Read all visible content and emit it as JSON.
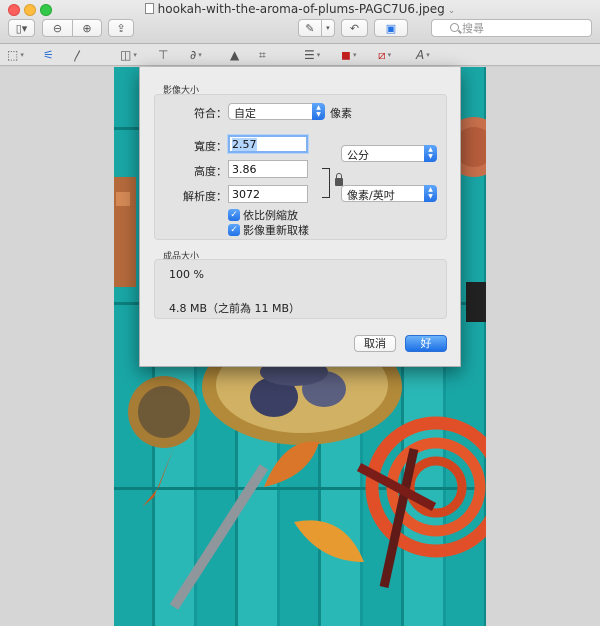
{
  "window": {
    "title": "hookah-with-the-aroma-of-plums-PAGC7U6.jpeg",
    "title_chevron": "⌄"
  },
  "toolbar": {
    "search_placeholder": "搜尋"
  },
  "dialog": {
    "image_size_label": "影像大小",
    "fit_label": "符合：",
    "fit_value": "自定",
    "fit_unit": "像素",
    "width_label": "寬度：",
    "width_value": "2.57",
    "height_label": "高度：",
    "height_value": "3.86",
    "size_unit": "公分",
    "resolution_label": "解析度：",
    "resolution_value": "3072",
    "resolution_unit": "像素/英吋",
    "scale_proportionally": "依比例縮放",
    "resample_image": "影像重新取樣",
    "result_size_label": "成品大小",
    "result_percent": "100 %",
    "result_size": "4.8 MB（之前為 11 MB）",
    "cancel_button": "取消",
    "ok_button": "好"
  },
  "colors": {
    "accent": "#2371e6",
    "photo_teal": "#19a7a6"
  },
  "icons": [
    "sidebar-icon",
    "zoom-out-icon",
    "zoom-in-icon",
    "share-icon",
    "pen-icon",
    "rotate-icon",
    "toolbox-icon",
    "search-icon",
    "selection-icon",
    "instant-alpha-icon",
    "sketch-icon",
    "shapes-icon",
    "text-icon",
    "sign-icon",
    "adjust-color-icon",
    "crop-icon",
    "line-style-icon",
    "border-color-icon",
    "fill-color-icon",
    "text-style-icon",
    "lock-icon",
    "checkbox-icon",
    "stepper-icon"
  ]
}
